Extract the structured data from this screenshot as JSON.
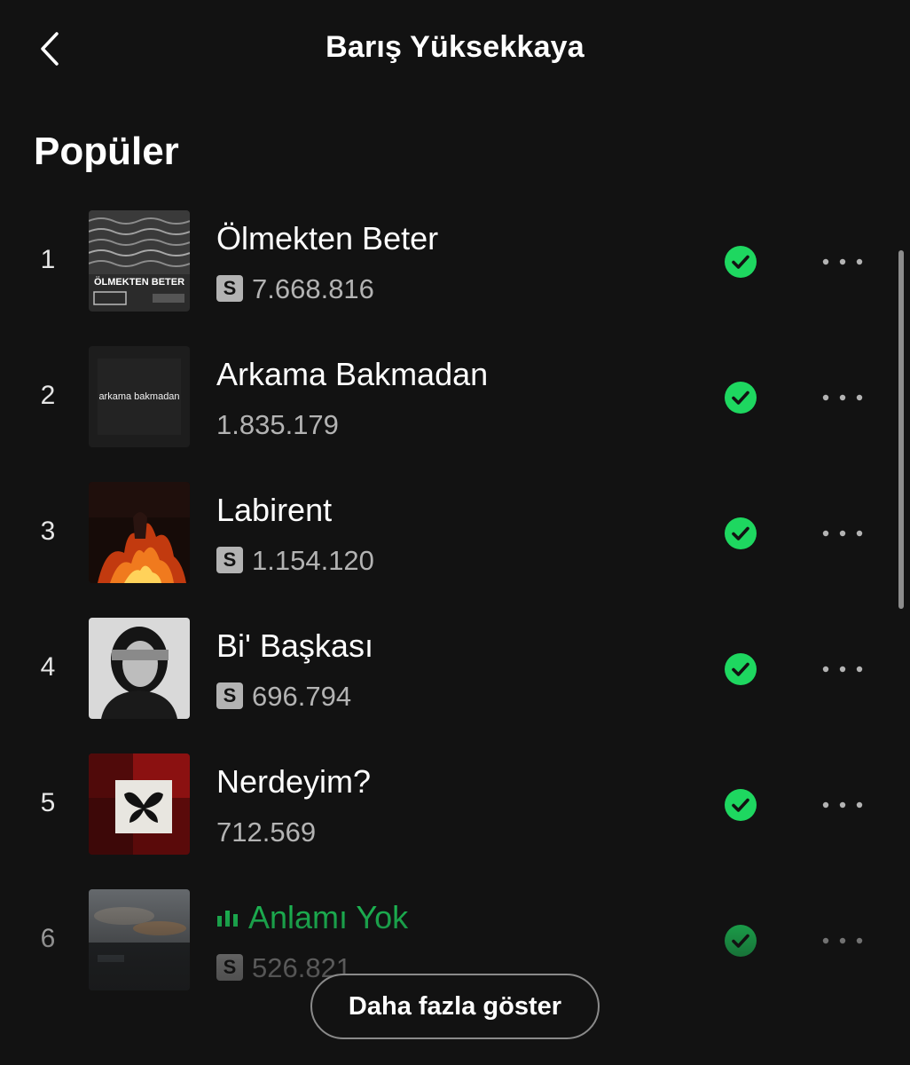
{
  "header": {
    "title": "Barış Yüksekkaya",
    "back_icon": "chevron-left-icon"
  },
  "section": {
    "title": "Popüler"
  },
  "tracks": [
    {
      "rank": "1",
      "title": "Ölmekten Beter",
      "plays": "7.668.816",
      "explicit": true,
      "playing": false,
      "saved": true,
      "cover_text": "ÖLMEKTEN BETER"
    },
    {
      "rank": "2",
      "title": "Arkama Bakmadan",
      "plays": "1.835.179",
      "explicit": false,
      "playing": false,
      "saved": true,
      "cover_text": "arkama bakmadan"
    },
    {
      "rank": "3",
      "title": "Labirent",
      "plays": "1.154.120",
      "explicit": true,
      "playing": false,
      "saved": true,
      "cover_text": ""
    },
    {
      "rank": "4",
      "title": "Bi' Başkası",
      "plays": "696.794",
      "explicit": true,
      "playing": false,
      "saved": true,
      "cover_text": ""
    },
    {
      "rank": "5",
      "title": "Nerdeyim?",
      "plays": "712.569",
      "explicit": false,
      "playing": false,
      "saved": true,
      "cover_text": ""
    },
    {
      "rank": "6",
      "title": "Anlamı Yok",
      "plays": "526.821",
      "explicit": true,
      "playing": true,
      "saved": true,
      "cover_text": ""
    }
  ],
  "explicit_badge": "S",
  "show_more_label": "Daha fazla göster",
  "colors": {
    "background": "#121212",
    "accent_green": "#1ed760",
    "text_primary": "#ffffff",
    "text_secondary": "#b3b3b3"
  }
}
